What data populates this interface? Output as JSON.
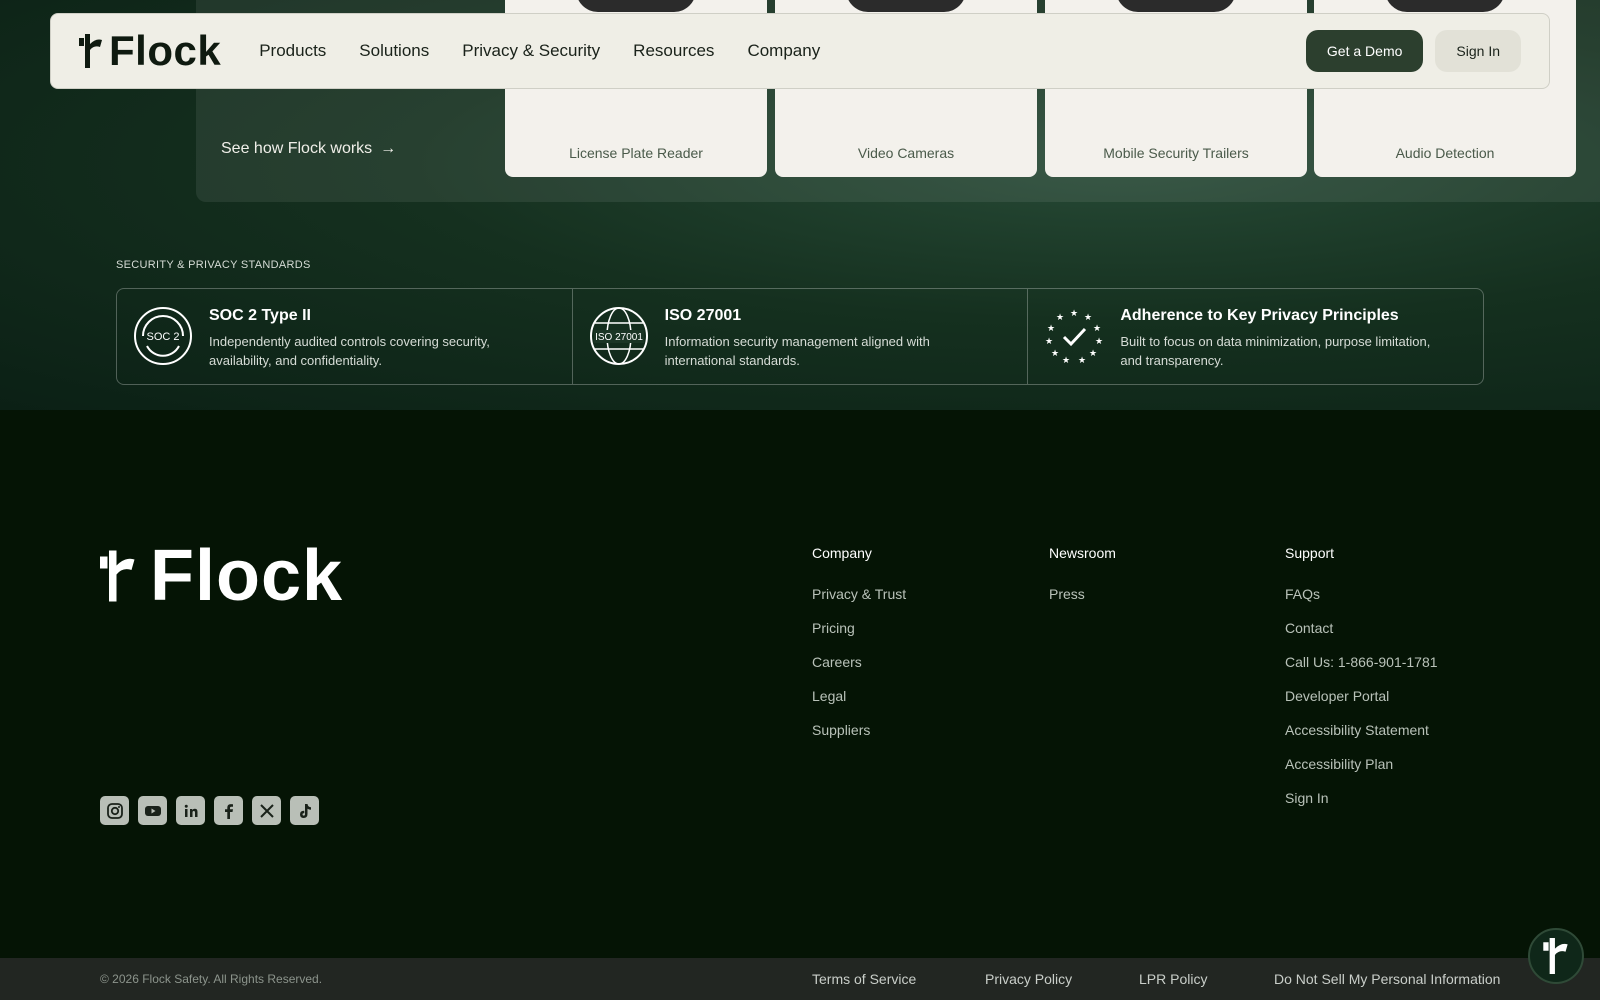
{
  "nav": {
    "brand": "Flock",
    "links": [
      "Products",
      "Solutions",
      "Privacy & Security",
      "Resources",
      "Company"
    ],
    "demo_label": "Get a Demo",
    "signin_label": "Sign In"
  },
  "hero": {
    "see_how": "See how Flock works",
    "arrow_icon": "arrow-right-icon",
    "products": [
      "License Plate Reader",
      "Video Cameras",
      "Mobile Security Trailers",
      "Audio Detection"
    ]
  },
  "standards": {
    "title": "SECURITY & PRIVACY STANDARDS",
    "items": [
      {
        "icon_text": "SOC 2",
        "title": "SOC 2 Type II",
        "desc": "Independently audited controls covering security, availability, and confidentiality."
      },
      {
        "icon_text": "ISO 27001",
        "title": "ISO 27001",
        "desc": "Information security management aligned with international standards."
      },
      {
        "icon_text": "",
        "title": "Adherence to Key Privacy Principles",
        "desc": "Built to focus on data minimization, purpose limitation, and transparency."
      }
    ]
  },
  "footer": {
    "brand": "Flock",
    "columns": [
      {
        "heading": "Company",
        "links": [
          "Privacy & Trust",
          "Pricing",
          "Careers",
          "Legal",
          "Suppliers"
        ]
      },
      {
        "heading": "Newsroom",
        "links": [
          "Press"
        ]
      },
      {
        "heading": "Support",
        "links": [
          "FAQs",
          "Contact",
          "Call Us: 1-866-901-1781",
          "Developer Portal",
          "Accessibility Statement",
          "Accessibility Plan",
          "Sign In"
        ]
      }
    ],
    "socials": [
      "instagram-icon",
      "youtube-icon",
      "linkedin-icon",
      "facebook-icon",
      "x-icon",
      "tiktok-icon"
    ],
    "copyright": "© 2026 Flock Safety. All Rights Reserved.",
    "legal": [
      "Terms of Service",
      "Privacy Policy",
      "LPR Policy",
      "Do Not Sell My Personal Information"
    ]
  },
  "colors": {
    "brand_dark": "#2c3f2e",
    "footer_bg": "#051405",
    "nav_bg": "#efeee6"
  }
}
